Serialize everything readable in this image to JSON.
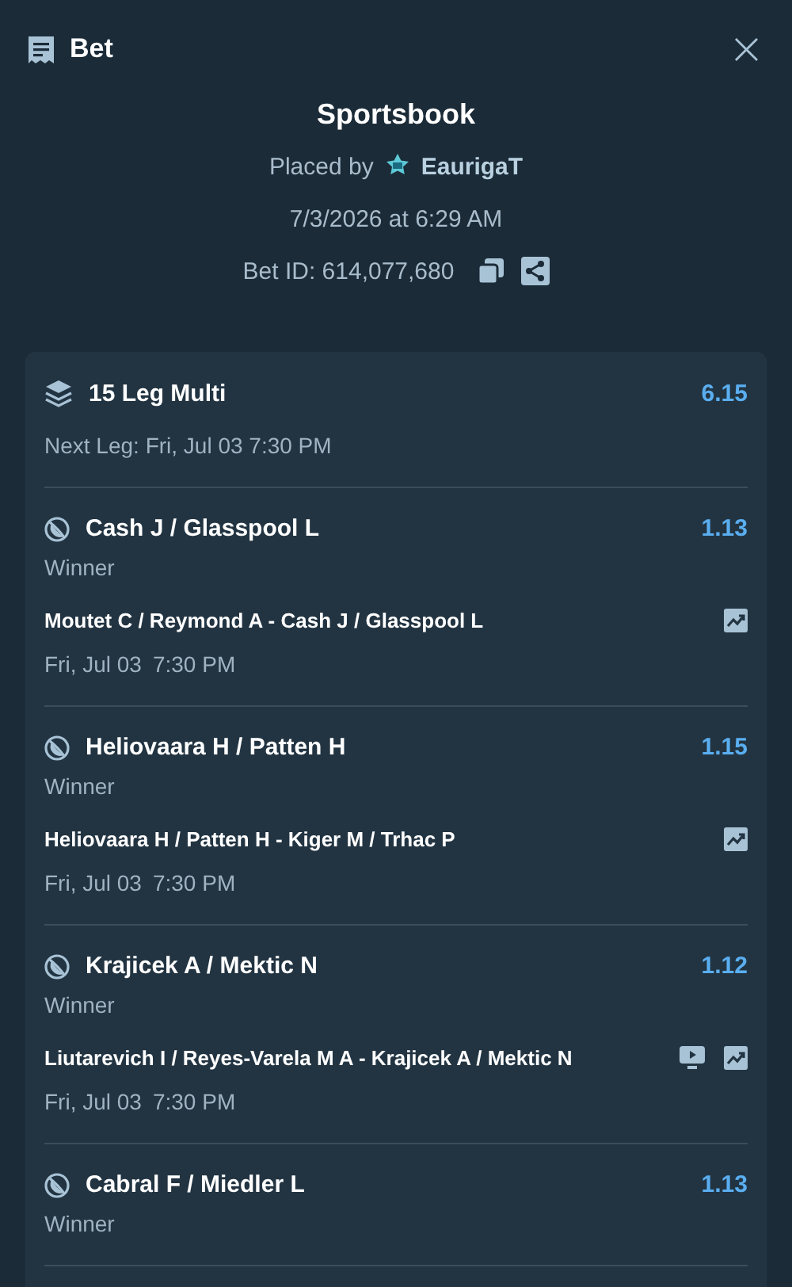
{
  "header": {
    "title": "Bet",
    "close": "×"
  },
  "summary": {
    "book": "Sportsbook",
    "placed_by_label": "Placed by",
    "user": "EaurigaT",
    "placed_at": "7/3/2026 at 6:29 AM",
    "bet_id": "Bet ID: 614,077,680"
  },
  "multi": {
    "title": "15 Leg Multi",
    "odds": "6.15",
    "next_leg": "Next Leg: Fri, Jul 03 7:30 PM"
  },
  "legs": [
    {
      "selection": "Cash J / Glasspool L",
      "odds": "1.13",
      "market": "Winner",
      "match": "Moutet C / Reymond A - Cash J / Glasspool L",
      "date": "Fri, Jul 03",
      "time": "7:30 PM",
      "actions": [
        {
          "kind": "stats"
        }
      ]
    },
    {
      "selection": "Heliovaara H / Patten H",
      "odds": "1.15",
      "market": "Winner",
      "match": "Heliovaara H / Patten H - Kiger M / Trhac P",
      "date": "Fri, Jul 03",
      "time": "7:30 PM",
      "actions": [
        {
          "kind": "stats"
        }
      ]
    },
    {
      "selection": "Krajicek A / Mektic N",
      "odds": "1.12",
      "market": "Winner",
      "match": "Liutarevich I / Reyes-Varela M A - Krajicek A / Mektic N",
      "date": "Fri, Jul 03",
      "time": "7:30 PM",
      "actions": [
        {
          "kind": "stream"
        },
        {
          "kind": "stats"
        }
      ]
    },
    {
      "selection": "Cabral F / Miedler L",
      "odds": "1.13",
      "market": "Winner"
    }
  ]
}
